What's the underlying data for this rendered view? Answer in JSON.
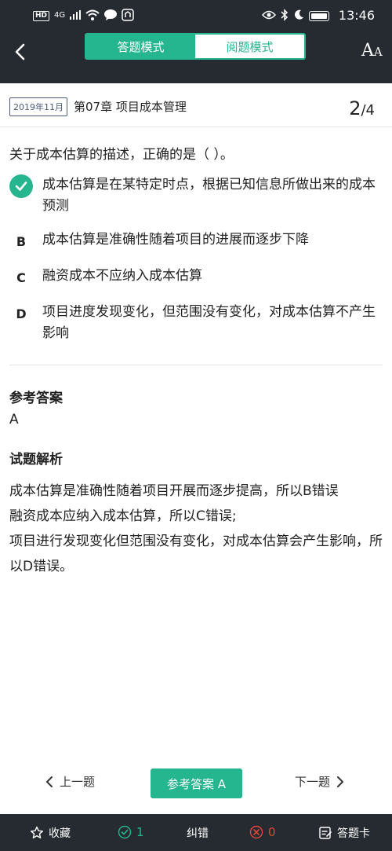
{
  "status_bar": {
    "hd": "HD",
    "signal": "4G",
    "time": "13:46"
  },
  "header": {
    "mode_tabs": [
      {
        "label": "答题模式",
        "active": true
      },
      {
        "label": "阅题模式",
        "active": false
      }
    ],
    "font_size_big": "A",
    "font_size_small": "A"
  },
  "question_header": {
    "year_tag": "2019年11月",
    "chapter": "第07章 项目成本管理",
    "current": "2",
    "separator": "/",
    "total": "4"
  },
  "question": {
    "text": "关于成本估算的描述，正确的是（ ）。",
    "options": [
      {
        "key": "A",
        "text": "成本估算是在某特定时点，根据已知信息所做出来的成本预测",
        "correct": true
      },
      {
        "key": "B",
        "text": "成本估算是准确性随着项目的进展而逐步下降",
        "correct": false
      },
      {
        "key": "C",
        "text": "融资成本不应纳入成本估算",
        "correct": false
      },
      {
        "key": "D",
        "text": "项目进度发现变化，但范围没有变化，对成本估算不产生影响",
        "correct": false
      }
    ]
  },
  "reference": {
    "title": "参考答案",
    "value": "A"
  },
  "analysis": {
    "title": "试题解析",
    "lines": [
      "成本估算是准确性随着项目开展而逐步提高，所以B错误",
      "融资成本应纳入成本估算，所以C错误;",
      "项目进行发现变化但范围没有变化，对成本估算会产生影响，所以D错误。"
    ]
  },
  "nav": {
    "prev_label": "上一题",
    "reference_label": "参考答案 A",
    "next_label": "下一题"
  },
  "bottom_bar": {
    "favorite_label": "收藏",
    "correct_count": "1",
    "report_label": "纠错",
    "wrong_count": "0",
    "answer_card_label": "答题卡"
  },
  "colors": {
    "accent": "#26b68f",
    "dark": "#262b31",
    "wrong": "#e0463c"
  }
}
